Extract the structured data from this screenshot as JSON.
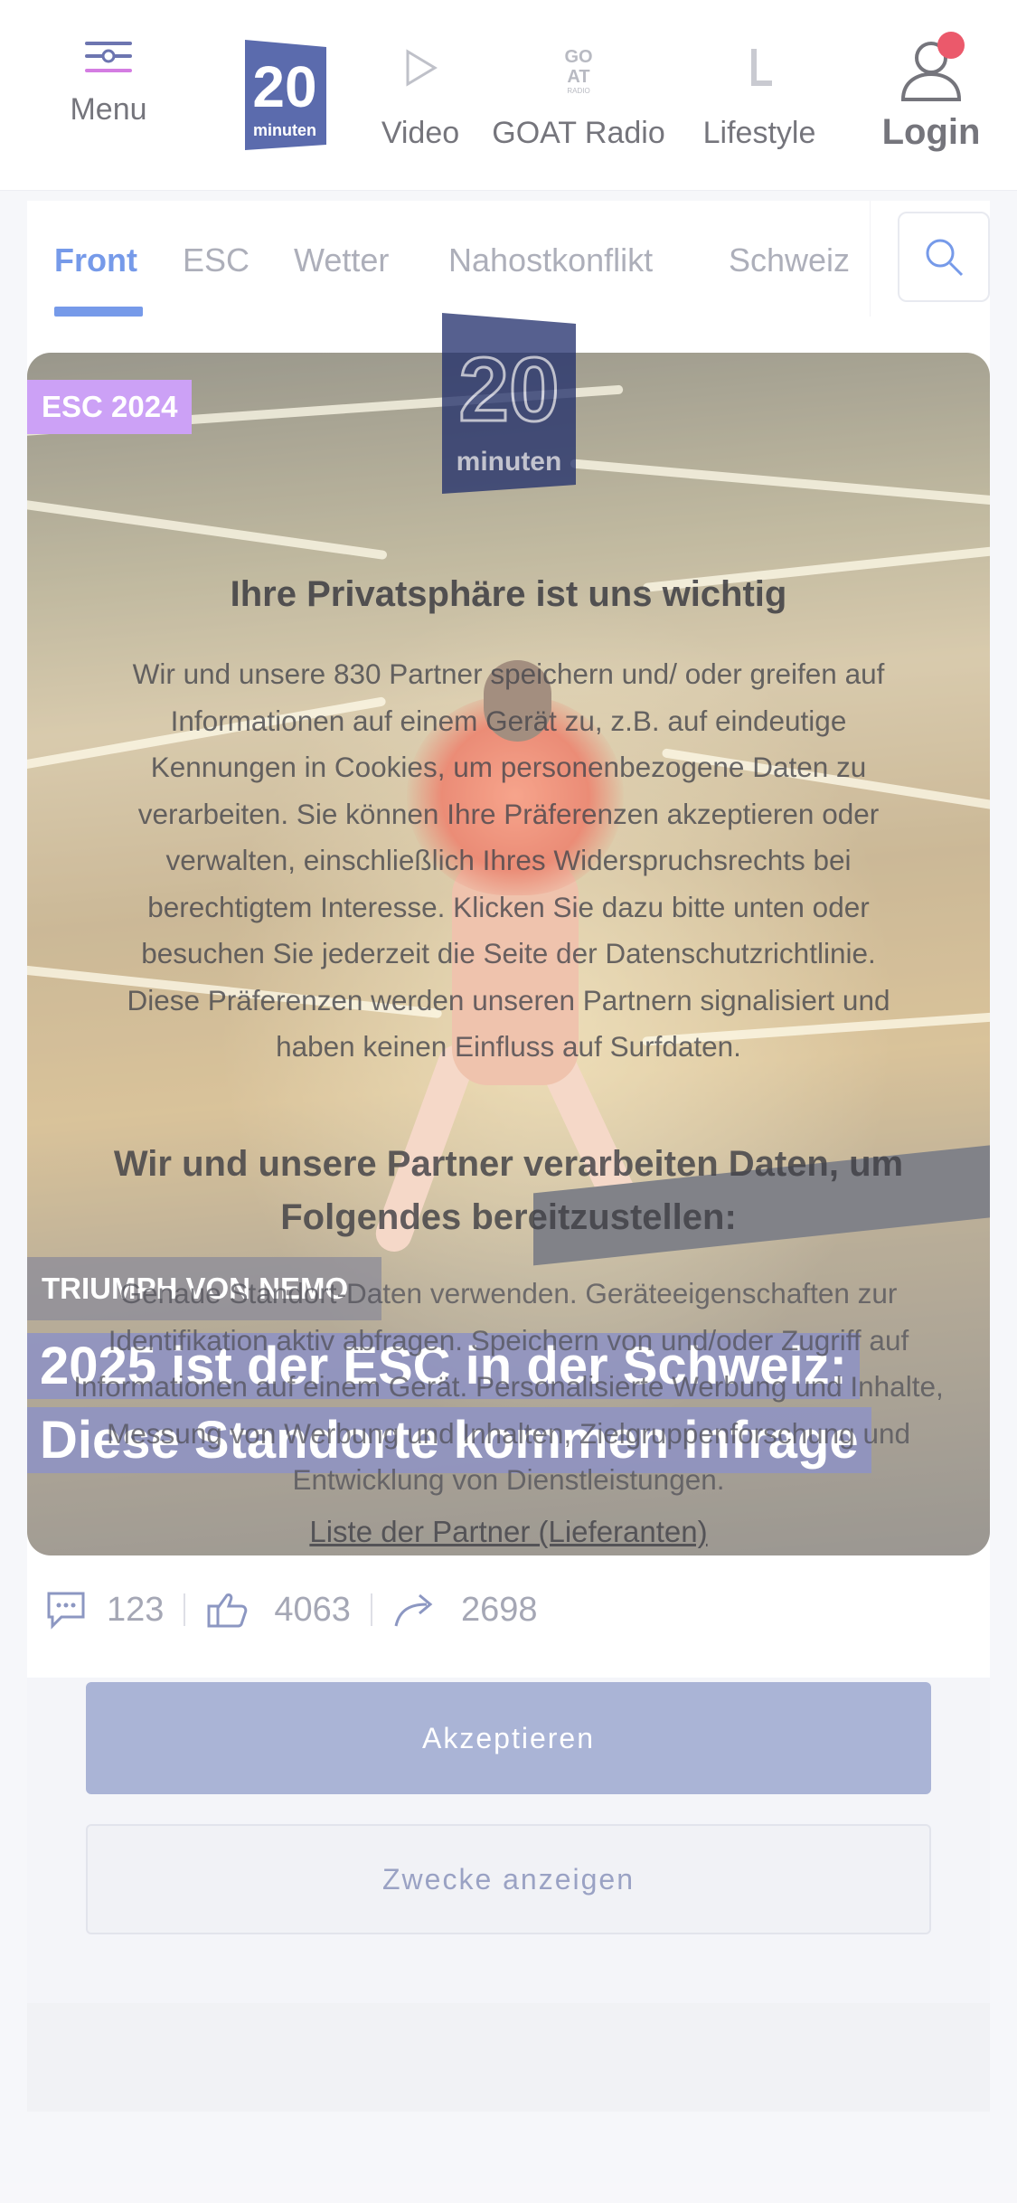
{
  "header": {
    "menu_label": "Menu",
    "nav": [
      {
        "label": "Video",
        "icon": "play-icon"
      },
      {
        "label": "GOAT Radio",
        "icon": "goat-radio-icon"
      },
      {
        "label": "Lifestyle",
        "icon": "lifestyle-icon"
      }
    ],
    "login_label": "Login",
    "logo_text": "20 minuten",
    "notification_color": "#e2122c"
  },
  "tabs": {
    "items": [
      "Front",
      "ESC",
      "Wetter",
      "Nahostkonflikt",
      "Schweiz"
    ],
    "active": "Front",
    "accent": "#3b6fe0"
  },
  "article": {
    "badge": "ESC 2024",
    "kicker": "TRIUMPH VON NEMO",
    "headline": "2025 ist der ESC in der Schweiz: Diese Standorte kommen infrage",
    "comments": "123",
    "reactions": "4063",
    "shares": "2698"
  },
  "consent": {
    "title": "Ihre Privatsphäre ist uns wichtig",
    "body": "Wir und unsere 830 Partner speichern und/ oder greifen auf Informationen auf einem Gerät zu, z.B. auf eindeutige Kennungen in Cookies, um personenbezogene Daten zu verarbeiten. Sie können Ihre Präferenzen akzeptieren oder verwalten, einschließlich Ihres Widerspruchsrechts bei berechtigtem Interesse. Klicken Sie dazu bitte unten oder besuchen Sie jederzeit die Seite der Datenschutzrichtlinie. Diese Präferenzen werden unseren Partnern signalisiert und haben keinen Einfluss auf Surfdaten.",
    "subtitle": "Wir und unsere Partner verarbeiten Daten, um Folgendes bereitzustellen:",
    "purposes": "Genaue Standort-Daten verwenden. Geräteeigenschaften zur Identifikation aktiv abfragen. Speichern von und/oder Zugriff auf Informationen auf einem Gerät. Personalisierte Werbung und Inhalte, Messung von Werbung und Inhalten, Zielgruppenforschung und Entwicklung von Dienstleistungen.",
    "partners_link": "Liste der Partner (Lieferanten)",
    "accept_label": "Akzeptieren",
    "purposes_button_label": "Zwecke anzeigen"
  }
}
